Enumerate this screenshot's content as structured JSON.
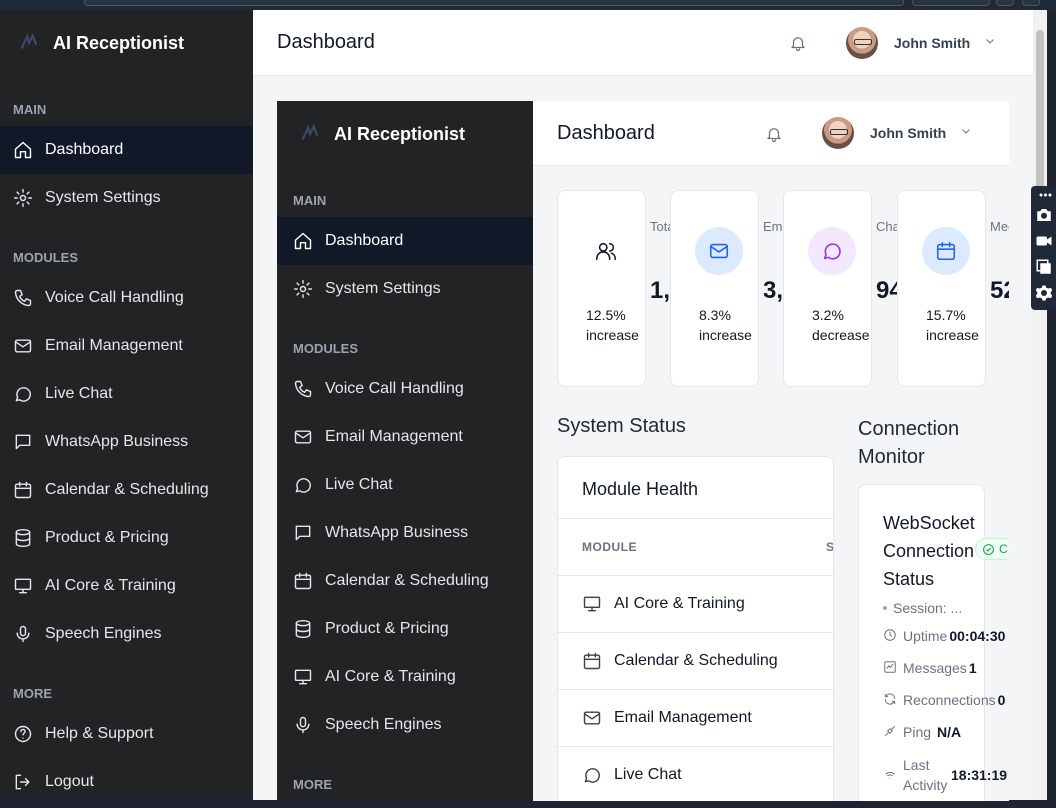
{
  "app": {
    "brand": "AI Receptionist",
    "sections": {
      "main": "MAIN",
      "modules": "MODULES",
      "more": "MORE"
    },
    "main_items": [
      "Dashboard",
      "System Settings"
    ],
    "module_items": [
      "Voice Call Handling",
      "Email Management",
      "Live Chat",
      "WhatsApp Business",
      "Calendar & Scheduling",
      "Product & Pricing",
      "AI Core & Training",
      "Speech Engines"
    ],
    "more_items": [
      "Help & Support",
      "Logout"
    ],
    "active": "Dashboard"
  },
  "header": {
    "title": "Dashboard",
    "user_name": "John Smith"
  },
  "stats": [
    {
      "label": "Total Calls Handled",
      "value": "1,",
      "change": "12.5% increase",
      "icon": "users-icon",
      "color": "#ffffff",
      "stroke": "#111827"
    },
    {
      "label": "Emails Processed",
      "value": "3,",
      "change": "8.3% increase",
      "icon": "mail-icon",
      "color": "#dbeafe",
      "stroke": "#2563eb"
    },
    {
      "label": "Chats Completed",
      "value": "94",
      "change": "3.2% decrease",
      "icon": "chat-icon",
      "color": "#f3e8ff",
      "stroke": "#9333ea"
    },
    {
      "label": "Meetings Scheduled",
      "value": "52",
      "change": "15.7% increase",
      "icon": "calendar-icon",
      "color": "#dbeafe",
      "stroke": "#2563eb"
    }
  ],
  "system_status": {
    "title": "System Status",
    "panel_title": "Module Health",
    "col_module": "MODULE",
    "col_status": "S",
    "rows": [
      "AI Core & Training",
      "Calendar & Scheduling",
      "Email Management",
      "Live Chat"
    ]
  },
  "connection": {
    "title": "Connection Monitor",
    "card_title": "WebSocket Connection Status",
    "badge": "C",
    "session": "Session: ...",
    "uptime_label": "Uptime",
    "uptime": "00:04:30",
    "messages_label": "Messages",
    "messages": "1",
    "reconnections_label": "Reconnections",
    "reconnections": "0",
    "ping_label": "Ping",
    "ping": "N/A",
    "last_activity_label": "Last Activity",
    "last_activity": "18:31:19"
  }
}
